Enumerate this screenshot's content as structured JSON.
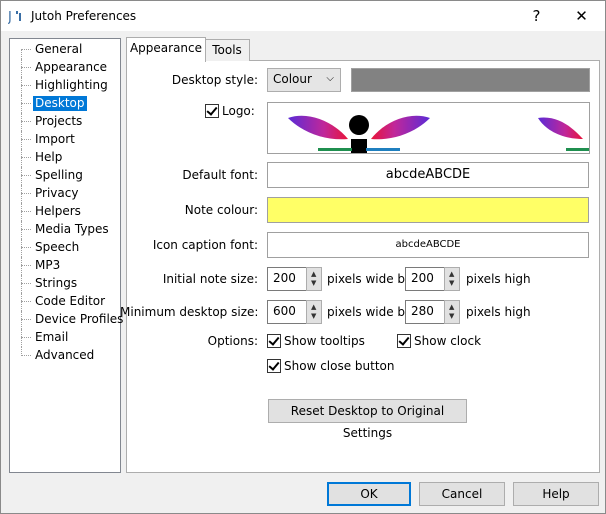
{
  "window": {
    "title": "Jutoh Preferences",
    "help_glyph": "?",
    "close_glyph": "✕",
    "icon": "jutoh-app-icon"
  },
  "sidebar": {
    "items": [
      {
        "label": "General"
      },
      {
        "label": "Appearance"
      },
      {
        "label": "Highlighting"
      },
      {
        "label": "Desktop",
        "selected": true
      },
      {
        "label": "Projects"
      },
      {
        "label": "Import"
      },
      {
        "label": "Help"
      },
      {
        "label": "Spelling"
      },
      {
        "label": "Privacy"
      },
      {
        "label": "Helpers"
      },
      {
        "label": "Media Types"
      },
      {
        "label": "Speech"
      },
      {
        "label": "MP3"
      },
      {
        "label": "Strings"
      },
      {
        "label": "Code Editor"
      },
      {
        "label": "Device Profiles"
      },
      {
        "label": "Email"
      },
      {
        "label": "Advanced"
      }
    ]
  },
  "tabs": [
    {
      "label": "Appearance",
      "active": true
    },
    {
      "label": "Tools",
      "active": false
    }
  ],
  "desktop": {
    "style_label": "Desktop style:",
    "style_value": "Colour",
    "style_color": "#828282",
    "logo_label": "Logo:",
    "logo_checked": true,
    "default_font_label": "Default font:",
    "default_font_sample": "abcdeABCDE",
    "note_colour_label": "Note colour:",
    "note_colour": "#ffff66",
    "icon_caption_label": "Icon caption font:",
    "icon_caption_sample": "abcdeABCDE",
    "initial_note_label": "Initial note size:",
    "initial_note_width": "200",
    "initial_note_height": "200",
    "min_desktop_label": "Minimum desktop size:",
    "min_desktop_width": "600",
    "min_desktop_height": "280",
    "pixels_wide_by": "pixels wide by",
    "pixels_high": "pixels high",
    "options_label": "Options:",
    "show_tooltips": "Show tooltips",
    "show_tooltips_checked": true,
    "show_clock": "Show clock",
    "show_clock_checked": true,
    "show_close_button": "Show close button",
    "show_close_button_checked": true,
    "reset_button": "Reset Desktop to Original Settings"
  },
  "footer": {
    "ok": "OK",
    "cancel": "Cancel",
    "help": "Help"
  }
}
